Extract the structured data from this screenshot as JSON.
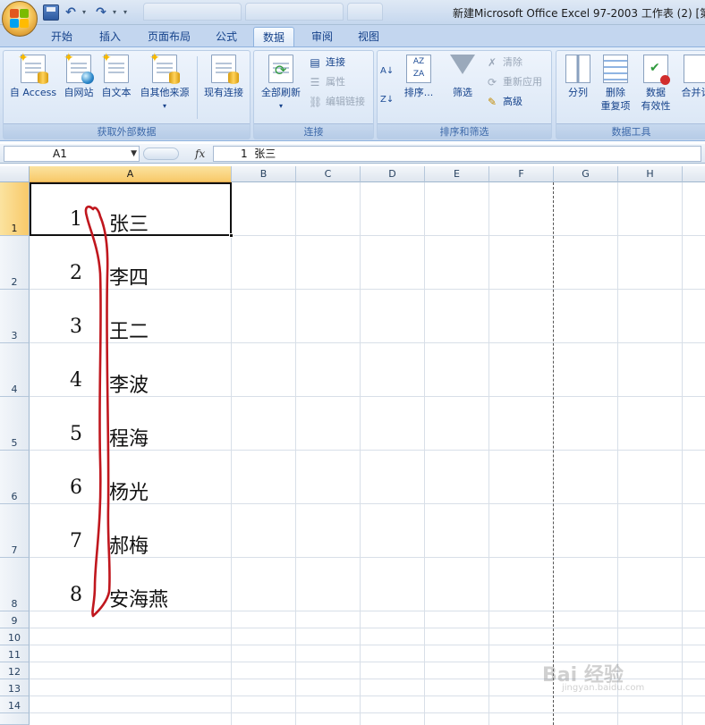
{
  "window": {
    "title": "新建Microsoft Office Excel 97-2003 工作表 (2)  [第"
  },
  "ribbon_tabs": [
    {
      "label": "开始",
      "active": false
    },
    {
      "label": "插入",
      "active": false
    },
    {
      "label": "页面布局",
      "active": false
    },
    {
      "label": "公式",
      "active": false
    },
    {
      "label": "数据",
      "active": true
    },
    {
      "label": "审阅",
      "active": false
    },
    {
      "label": "视图",
      "active": false
    }
  ],
  "groups": {
    "external": {
      "label": "获取外部数据",
      "buttons": [
        "自 Access",
        "自网站",
        "自文本",
        "自其他来源",
        "现有连接"
      ]
    },
    "connections": {
      "label": "连接",
      "refresh_all": "全部刷新",
      "small": [
        "连接",
        "属性",
        "编辑链接"
      ]
    },
    "sort_filter": {
      "label": "排序和筛选",
      "sort": "排序...",
      "filter": "筛选",
      "small": [
        "清除",
        "重新应用",
        "高级"
      ]
    },
    "data_tools": {
      "label": "数据工具",
      "split": "分列",
      "remove_dup_1": "删除",
      "remove_dup_2": "重复项",
      "validation_1": "数据",
      "validation_2": "有效性",
      "consolidate": "合并计"
    }
  },
  "formula_bar": {
    "name_box": "A1",
    "fx": "fx",
    "content": "1  张三"
  },
  "columns": [
    "A",
    "B",
    "C",
    "D",
    "E",
    "F",
    "G",
    "H"
  ],
  "rows": [
    "1",
    "2",
    "3",
    "4",
    "5",
    "6",
    "7",
    "8",
    "9",
    "10",
    "11",
    "12",
    "13",
    "14"
  ],
  "cells": [
    {
      "num": "1",
      "name": "张三"
    },
    {
      "num": "2",
      "name": "李四"
    },
    {
      "num": "3",
      "name": "王二"
    },
    {
      "num": "4",
      "name": "李波"
    },
    {
      "num": "5",
      "name": "程海"
    },
    {
      "num": "6",
      "name": "杨光"
    },
    {
      "num": "7",
      "name": "郝梅"
    },
    {
      "num": "8",
      "name": "安海燕"
    }
  ],
  "watermark": {
    "brand": "Bai 经验",
    "url": "jingyan.baidu.com"
  },
  "colors": {
    "annotation": "#c0171e",
    "selected_header": "#f8c969",
    "accent": "#15428b"
  }
}
